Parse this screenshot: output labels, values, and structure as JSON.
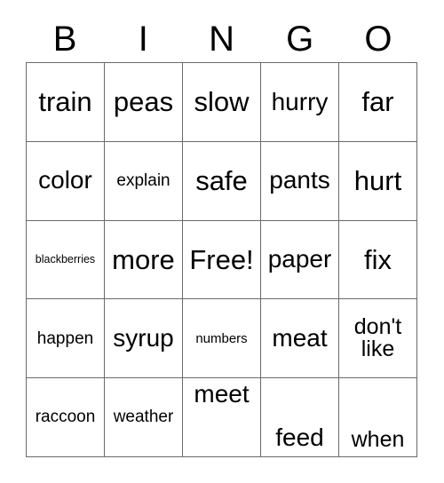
{
  "card": {
    "title": "BINGO",
    "header_letters": [
      "B",
      "I",
      "N",
      "G",
      "O"
    ],
    "colors": {
      "text": "#000000",
      "border": "#6a6a6a",
      "background": "#ffffff"
    },
    "grid": {
      "rows": 5,
      "columns": 5,
      "free_space_label": "Free!",
      "free_space_position": {
        "row": 3,
        "column": 3
      }
    },
    "cells": [
      [
        {
          "text": "train",
          "size": "xl"
        },
        {
          "text": "peas",
          "size": "xl"
        },
        {
          "text": "slow",
          "size": "xl"
        },
        {
          "text": "hurry",
          "size": "lg"
        },
        {
          "text": "far",
          "size": "xl"
        }
      ],
      [
        {
          "text": "color",
          "size": "lg"
        },
        {
          "text": "explain",
          "size": "sm"
        },
        {
          "text": "safe",
          "size": "xl"
        },
        {
          "text": "pants",
          "size": "lg"
        },
        {
          "text": "hurt",
          "size": "xl"
        }
      ],
      [
        {
          "text": "blackberries",
          "size": "xxs"
        },
        {
          "text": "more",
          "size": "xl"
        },
        {
          "text": "Free!",
          "size": "xl"
        },
        {
          "text": "paper",
          "size": "lg"
        },
        {
          "text": "fix",
          "size": "xl"
        }
      ],
      [
        {
          "text": "happen",
          "size": "sm"
        },
        {
          "text": "syrup",
          "size": "lg"
        },
        {
          "text": "numbers",
          "size": "xs"
        },
        {
          "text": "meat",
          "size": "lg"
        },
        {
          "text": "don't\nlike",
          "size": "md"
        }
      ],
      [
        {
          "text": "raccoon",
          "size": "sm"
        },
        {
          "text": "weather",
          "size": "sm"
        },
        {
          "text": "meet",
          "size": "lg",
          "valign": "top"
        },
        {
          "text": "feed",
          "size": "lg",
          "valign": "bottom"
        },
        {
          "text": "when",
          "size": "md",
          "valign": "bottom"
        }
      ]
    ]
  }
}
